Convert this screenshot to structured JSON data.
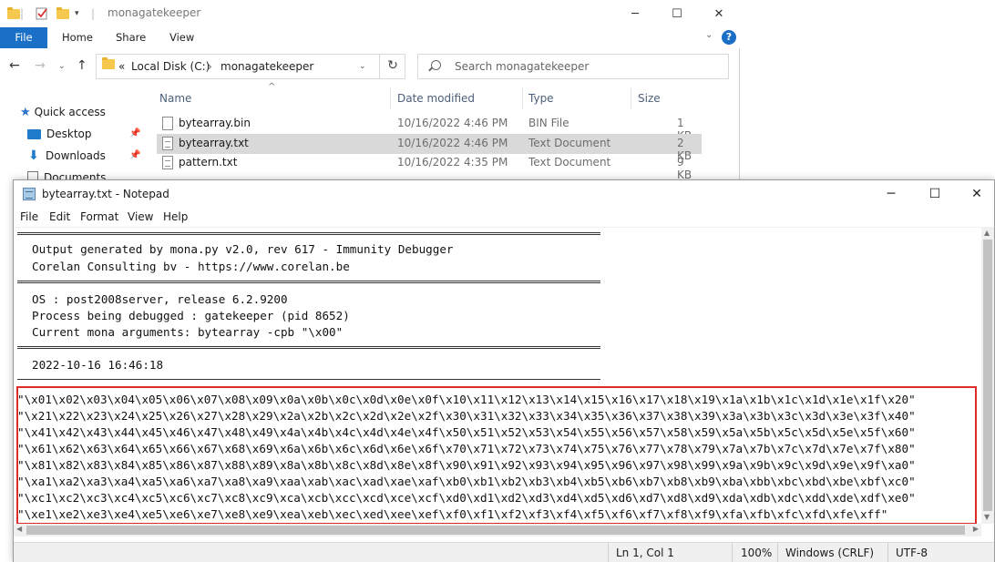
{
  "explorer": {
    "title": "monagatekeeper",
    "ribbon_tabs": [
      "File",
      "Home",
      "Share",
      "View"
    ],
    "address": {
      "overflow": "«",
      "drive": "Local Disk (C:)",
      "folder": "monagatekeeper"
    },
    "search_placeholder": "Search monagatekeeper",
    "columns": {
      "name": "Name",
      "date": "Date modified",
      "type": "Type",
      "size": "Size"
    },
    "nav": {
      "quick_access": "Quick access",
      "items": [
        "Desktop",
        "Downloads",
        "Documents"
      ]
    },
    "files": [
      {
        "name": "bytearray.bin",
        "date": "10/16/2022 4:46 PM",
        "type": "BIN File",
        "size": "1 KB"
      },
      {
        "name": "bytearray.txt",
        "date": "10/16/2022 4:46 PM",
        "type": "Text Document",
        "size": "2 KB"
      },
      {
        "name": "pattern.txt",
        "date": "10/16/2022 4:35 PM",
        "type": "Text Document",
        "size": "9 KB"
      }
    ]
  },
  "notepad": {
    "title": "bytearray.txt - Notepad",
    "menu": [
      "File",
      "Edit",
      "Format",
      "View",
      "Help"
    ],
    "header_lines": [
      "Output generated by mona.py v2.0, rev 617 - Immunity Debugger",
      "Corelan Consulting bv - https://www.corelan.be"
    ],
    "info_lines": [
      "OS : post2008server, release 6.2.9200",
      "Process being debugged : gatekeeper (pid 8652)",
      "Current mona arguments: bytearray -cpb \"\\x00\""
    ],
    "timestamp": "2022-10-16 16:46:18",
    "byte_lines": [
      "\"\\x01\\x02\\x03\\x04\\x05\\x06\\x07\\x08\\x09\\x0a\\x0b\\x0c\\x0d\\x0e\\x0f\\x10\\x11\\x12\\x13\\x14\\x15\\x16\\x17\\x18\\x19\\x1a\\x1b\\x1c\\x1d\\x1e\\x1f\\x20\"",
      "\"\\x21\\x22\\x23\\x24\\x25\\x26\\x27\\x28\\x29\\x2a\\x2b\\x2c\\x2d\\x2e\\x2f\\x30\\x31\\x32\\x33\\x34\\x35\\x36\\x37\\x38\\x39\\x3a\\x3b\\x3c\\x3d\\x3e\\x3f\\x40\"",
      "\"\\x41\\x42\\x43\\x44\\x45\\x46\\x47\\x48\\x49\\x4a\\x4b\\x4c\\x4d\\x4e\\x4f\\x50\\x51\\x52\\x53\\x54\\x55\\x56\\x57\\x58\\x59\\x5a\\x5b\\x5c\\x5d\\x5e\\x5f\\x60\"",
      "\"\\x61\\x62\\x63\\x64\\x65\\x66\\x67\\x68\\x69\\x6a\\x6b\\x6c\\x6d\\x6e\\x6f\\x70\\x71\\x72\\x73\\x74\\x75\\x76\\x77\\x78\\x79\\x7a\\x7b\\x7c\\x7d\\x7e\\x7f\\x80\"",
      "\"\\x81\\x82\\x83\\x84\\x85\\x86\\x87\\x88\\x89\\x8a\\x8b\\x8c\\x8d\\x8e\\x8f\\x90\\x91\\x92\\x93\\x94\\x95\\x96\\x97\\x98\\x99\\x9a\\x9b\\x9c\\x9d\\x9e\\x9f\\xa0\"",
      "\"\\xa1\\xa2\\xa3\\xa4\\xa5\\xa6\\xa7\\xa8\\xa9\\xaa\\xab\\xac\\xad\\xae\\xaf\\xb0\\xb1\\xb2\\xb3\\xb4\\xb5\\xb6\\xb7\\xb8\\xb9\\xba\\xbb\\xbc\\xbd\\xbe\\xbf\\xc0\"",
      "\"\\xc1\\xc2\\xc3\\xc4\\xc5\\xc6\\xc7\\xc8\\xc9\\xca\\xcb\\xcc\\xcd\\xce\\xcf\\xd0\\xd1\\xd2\\xd3\\xd4\\xd5\\xd6\\xd7\\xd8\\xd9\\xda\\xdb\\xdc\\xdd\\xde\\xdf\\xe0\"",
      "\"\\xe1\\xe2\\xe3\\xe4\\xe5\\xe6\\xe7\\xe8\\xe9\\xea\\xeb\\xec\\xed\\xee\\xef\\xf0\\xf1\\xf2\\xf3\\xf4\\xf5\\xf6\\xf7\\xf8\\xf9\\xfa\\xfb\\xfc\\xfd\\xfe\\xff\""
    ],
    "status": {
      "position": "Ln 1, Col 1",
      "zoom": "100%",
      "line_ending": "Windows (CRLF)",
      "encoding": "UTF-8"
    }
  },
  "colors": {
    "accent": "#1a6fc6",
    "highlight_box": "#e02b2b",
    "selected_row": "#d9d9d9"
  }
}
